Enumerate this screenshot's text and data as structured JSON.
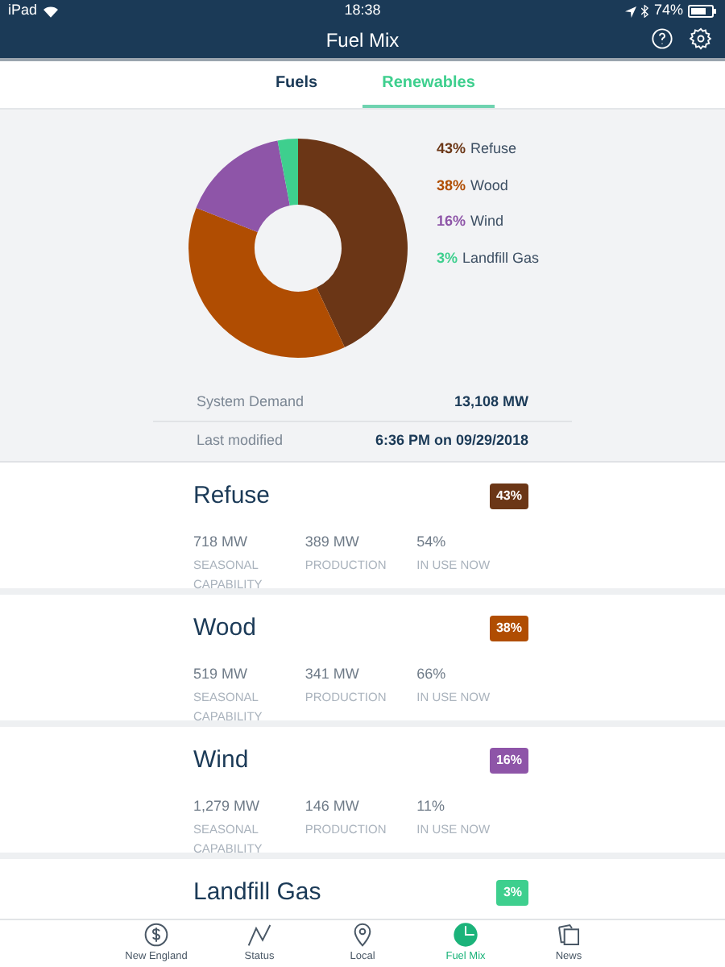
{
  "status_bar": {
    "device": "iPad",
    "time": "18:38",
    "battery": "74%"
  },
  "header": {
    "title": "Fuel Mix"
  },
  "tabs": [
    {
      "label": "Fuels",
      "selected": false
    },
    {
      "label": "Renewables",
      "selected": true
    }
  ],
  "chart": {
    "chart_data": {
      "type": "donut",
      "categories": [
        "Refuse",
        "Wood",
        "Wind",
        "Landfill Gas"
      ],
      "values": [
        43,
        38,
        16,
        3
      ]
    },
    "legend": [
      {
        "percent": "43%",
        "color": "#6b3616"
      },
      {
        "percent": "38%",
        "color": "#b04d02"
      },
      {
        "percent": "16%",
        "color": "#8e55a8"
      },
      {
        "percent": "3%",
        "color": "#3ecf8e"
      }
    ]
  },
  "summary": [
    {
      "label": "System Demand",
      "value": "13,108 MW"
    },
    {
      "label": "Last modified",
      "value": "6:36 PM on 09/29/2018"
    }
  ],
  "fuels": [
    {
      "name": "Refuse",
      "percent": "43%",
      "color": "#6b3616",
      "stats": [
        {
          "value": "718 MW",
          "label": "SEASONAL CAPABILITY"
        },
        {
          "value": "389 MW",
          "label": "PRODUCTION"
        },
        {
          "value": "54%",
          "label": "IN USE NOW"
        }
      ]
    },
    {
      "name": "Wood",
      "percent": "38%",
      "color": "#b04d02",
      "stats": [
        {
          "value": "519 MW",
          "label": "SEASONAL CAPABILITY"
        },
        {
          "value": "341 MW",
          "label": "PRODUCTION"
        },
        {
          "value": "66%",
          "label": "IN USE NOW"
        }
      ]
    },
    {
      "name": "Wind",
      "percent": "16%",
      "color": "#8e55a8",
      "stats": [
        {
          "value": "1,279 MW",
          "label": "SEASONAL CAPABILITY"
        },
        {
          "value": "146 MW",
          "label": "PRODUCTION"
        },
        {
          "value": "11%",
          "label": "IN USE NOW"
        }
      ]
    },
    {
      "name": "Landfill Gas",
      "percent": "3%",
      "color": "#3ecf8e"
    }
  ],
  "tab_bar": [
    {
      "label": "New England",
      "kind": "dollar",
      "selected": false
    },
    {
      "label": "Status",
      "kind": "line",
      "selected": false
    },
    {
      "label": "Local",
      "kind": "pin",
      "selected": false
    },
    {
      "label": "Fuel Mix",
      "kind": "pie",
      "selected": true
    },
    {
      "label": "News",
      "kind": "news",
      "selected": false
    }
  ]
}
